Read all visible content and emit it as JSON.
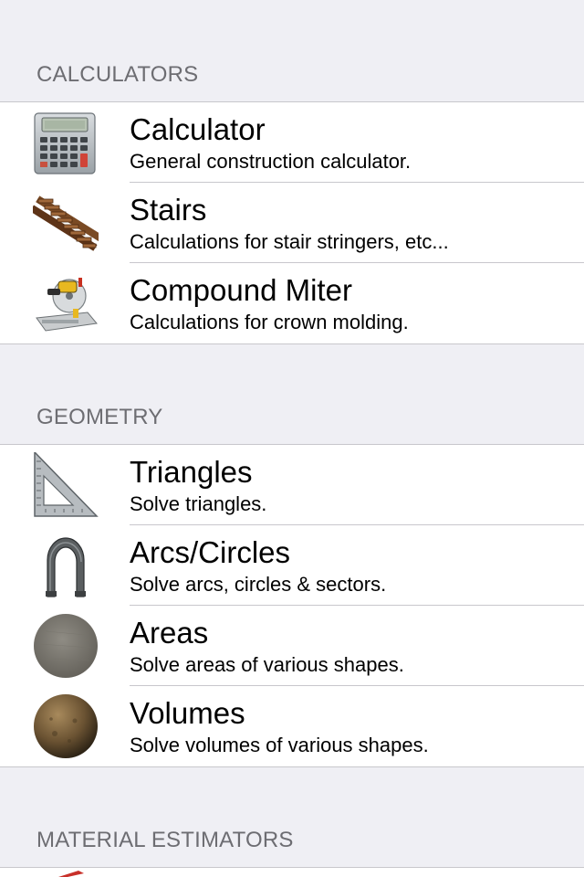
{
  "sections": [
    {
      "header": "CALCULATORS",
      "items": [
        {
          "title": "Calculator",
          "subtitle": "General construction calculator.",
          "icon": "calculator-icon"
        },
        {
          "title": "Stairs",
          "subtitle": "Calculations for stair stringers, etc...",
          "icon": "stairs-icon"
        },
        {
          "title": "Compound Miter",
          "subtitle": "Calculations for crown molding.",
          "icon": "miter-saw-icon"
        }
      ]
    },
    {
      "header": "GEOMETRY",
      "items": [
        {
          "title": "Triangles",
          "subtitle": "Solve triangles.",
          "icon": "speed-square-icon"
        },
        {
          "title": "Arcs/Circles",
          "subtitle": "Solve arcs, circles & sectors.",
          "icon": "arch-icon"
        },
        {
          "title": "Areas",
          "subtitle": "Solve areas of various shapes.",
          "icon": "disc-icon"
        },
        {
          "title": "Volumes",
          "subtitle": "Solve volumes of various shapes.",
          "icon": "sphere-icon"
        }
      ]
    },
    {
      "header": "MATERIAL ESTIMATORS",
      "items": []
    }
  ],
  "colors": {
    "background": "#efeff4",
    "header_text": "#6d6d72",
    "separator": "#c8c7cc",
    "cell": "#ffffff"
  }
}
